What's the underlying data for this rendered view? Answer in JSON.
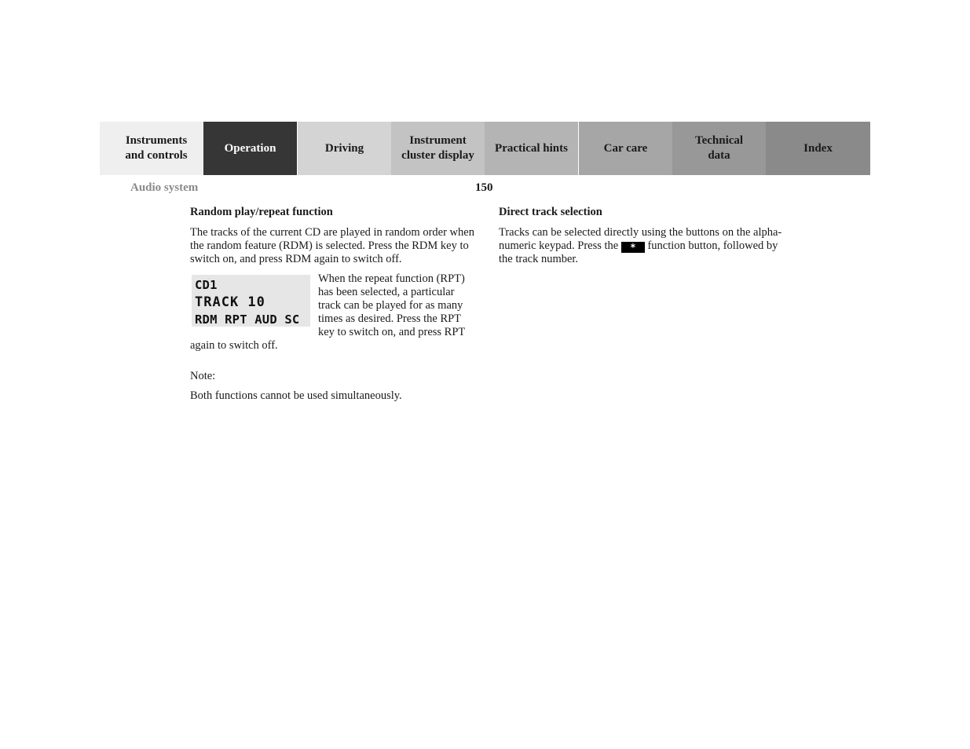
{
  "tabs": [
    {
      "label": "Instruments\nand controls",
      "active": false,
      "color": "#efefef"
    },
    {
      "label": "Operation",
      "active": true,
      "color": "#363636"
    },
    {
      "label": "Driving",
      "active": false,
      "color": "#d4d4d4"
    },
    {
      "label": "Instrument\ncluster display",
      "active": false,
      "color": "#c3c3c3"
    },
    {
      "label": "Practical hints",
      "active": false,
      "color": "#b4b4b4"
    },
    {
      "label": "Car care",
      "active": false,
      "color": "#a6a6a6"
    },
    {
      "label": "Technical\ndata",
      "active": false,
      "color": "#989898"
    },
    {
      "label": "Index",
      "active": false,
      "color": "#8a8a8a"
    }
  ],
  "header": {
    "section": "Audio system",
    "page_number": "150"
  },
  "left_column": {
    "heading": "Random play/repeat function",
    "paragraph1": "The tracks of the current CD are played in random order when the random feature (RDM) is selected. Press the RDM key to switch on, and press RDM again to switch off.",
    "display": {
      "line1": "CD1",
      "line2": "TRACK 10",
      "line3": "RDM RPT AUD SC"
    },
    "paragraph2": "When the repeat function (RPT) has been selected, a particular track can be played for as many times as desired. Press the RPT key to switch on, and press RPT again to switch off.",
    "note_label": "Note:",
    "note_text": "Both functions cannot be used simultaneously."
  },
  "right_column": {
    "heading": "Direct track selection",
    "text_before": "Tracks can be selected directly using the buttons on the alpha-numeric keypad. Press the",
    "key_symbol": "*",
    "text_after": "function button, followed by the track number."
  }
}
